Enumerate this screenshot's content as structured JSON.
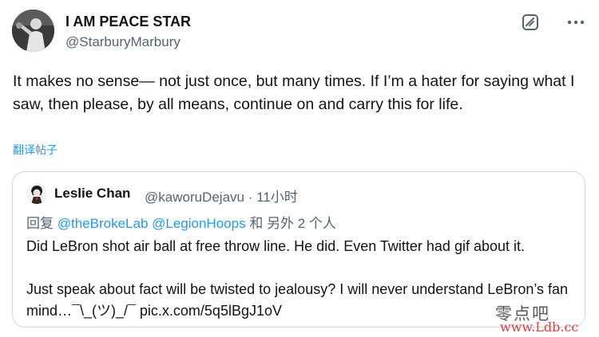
{
  "tweet": {
    "author_name": "I AM PEACE STAR",
    "author_handle": "@StarburyMarbury",
    "text": "It makes no sense— not just once, but many times. If I’m a hater for saying what I saw, then please, by all means, continue on and carry this for life.",
    "translate_label": "翻译帖子",
    "grok_icon": "grok-icon",
    "more_icon": "more-horizontal-icon"
  },
  "quote": {
    "author_name": "Leslie Chan",
    "author_handle": "@kaworuDejavu",
    "separator": "·",
    "time": "11小时",
    "reply_prefix": "回复",
    "reply_mentions": "@theBrokeLab @LegionHoops",
    "reply_suffix": "和 另外 2 个人",
    "text_line1": "Did LeBron shot air ball at free throw line. He did. Even Twitter had gif about it.",
    "text_line2": "Just speak about fact will be twisted to jealousy?  I will never understand LeBron’s fan mind…¯\\_(ツ)_/¯ pic.x.com/5q5lBgJ1oV"
  },
  "watermark": {
    "site_name": "零点吧",
    "site_url": "www.Ldb.cc"
  },
  "colors": {
    "link": "#1d9bf0",
    "secondary_text": "#536471",
    "primary_text": "#0f1419",
    "border": "#cfd9de"
  }
}
